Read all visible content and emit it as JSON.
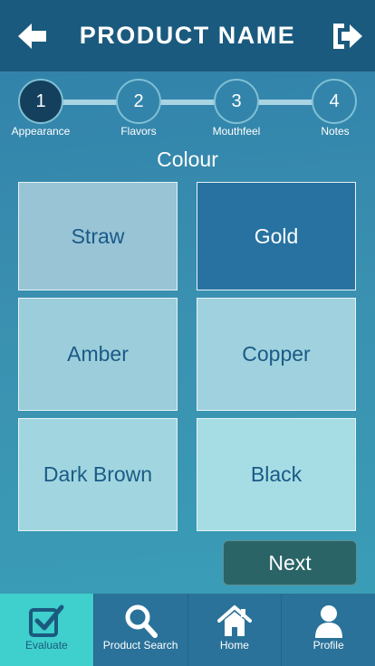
{
  "header": {
    "title": "PRODUCT NAME"
  },
  "steps": [
    {
      "number": "1",
      "label": "Appearance",
      "active": true
    },
    {
      "number": "2",
      "label": "Flavors"
    },
    {
      "number": "3",
      "label": "Mouthfeel"
    },
    {
      "number": "4",
      "label": "Notes"
    }
  ],
  "section": {
    "title": "Colour"
  },
  "colours": [
    {
      "label": "Straw",
      "selected": false
    },
    {
      "label": "Gold",
      "selected": true
    },
    {
      "label": "Amber",
      "selected": false
    },
    {
      "label": "Copper",
      "selected": false
    },
    {
      "label": "Dark Brown",
      "selected": false
    },
    {
      "label": "Black",
      "selected": false
    }
  ],
  "next_label": "Next",
  "tabs": [
    {
      "label": "Evaluate",
      "icon": "checkbox-icon",
      "active": true
    },
    {
      "label": "Product Search",
      "icon": "search-icon"
    },
    {
      "label": "Home",
      "icon": "home-icon"
    },
    {
      "label": "Profile",
      "icon": "person-icon"
    }
  ],
  "colors": {
    "header": "#1a5a7e",
    "accent": "#3fcfcc",
    "selected_tile": "#2872a2",
    "next_button": "#2a6467"
  }
}
